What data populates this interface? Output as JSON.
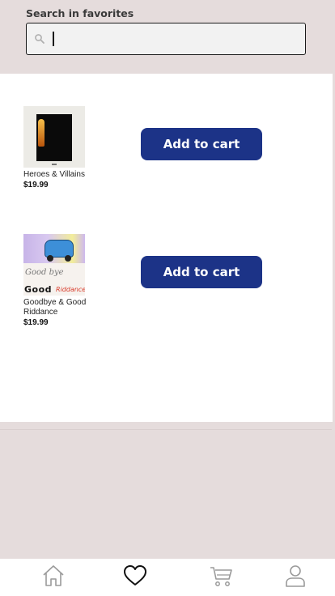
{
  "search": {
    "label": "Search in favorites",
    "value": "",
    "placeholder": ""
  },
  "favorites": [
    {
      "title": "Heroes & Villains",
      "price": "$19.99",
      "button_label": "Add to cart"
    },
    {
      "title": "Goodbye & Good Riddance",
      "price": "$19.99",
      "button_label": "Add to cart"
    }
  ],
  "nav": {
    "items": [
      "home-icon",
      "heart-icon",
      "cart-icon",
      "profile-icon"
    ],
    "active": "heart-icon"
  },
  "colors": {
    "background": "#e5dcdc",
    "button": "#1c3387",
    "nav_inactive": "#9a9a9a",
    "nav_active": "#111111"
  }
}
